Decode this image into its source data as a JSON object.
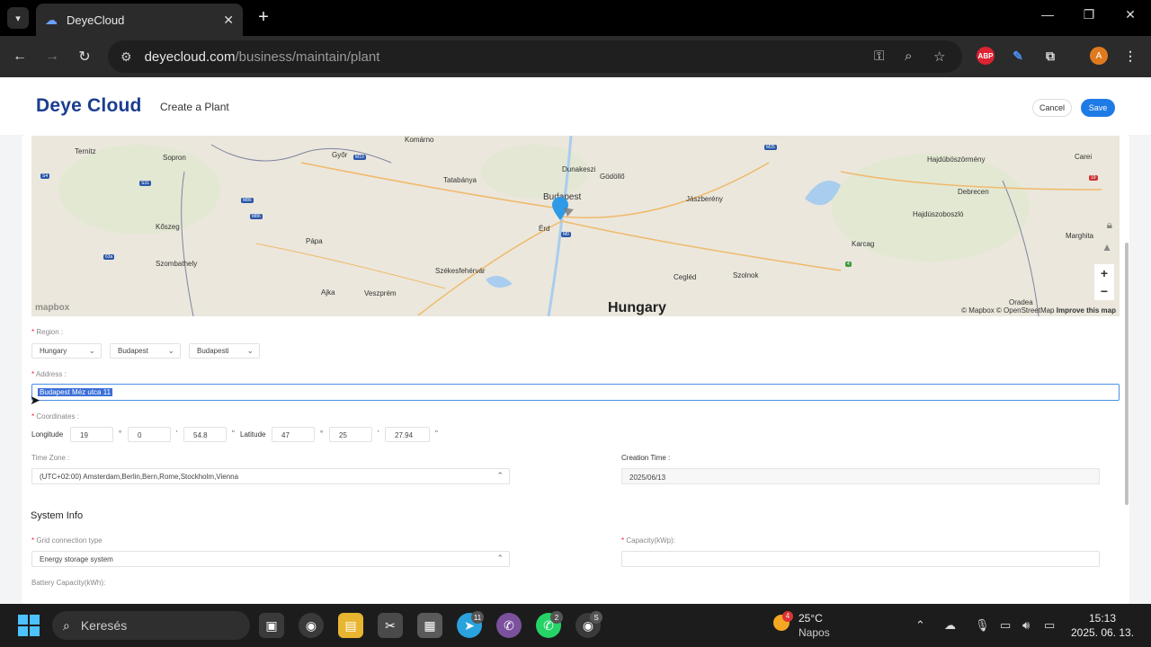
{
  "browser": {
    "tab_title": "DeyeCloud",
    "url_host": "deyecloud.com",
    "url_path": "/business/maintain/plant",
    "profile_initial": "A"
  },
  "app": {
    "logo": "Deye Cloud",
    "page_title": "Create a Plant",
    "cancel_label": "Cancel",
    "save_label": "Save"
  },
  "map": {
    "country_label": "Hungary",
    "attribution": "© Mapbox © OpenStreetMap",
    "improve": "Improve this map",
    "logo": "mapbox",
    "places": [
      "Komárno",
      "Ternitz",
      "Sopron",
      "Győr",
      "Tatabánya",
      "Dunakeszi",
      "Gödöllő",
      "Budapest",
      "Érd",
      "Jászberény",
      "Hajdúböszörmény",
      "Debrecen",
      "Hajdúszoboszló",
      "Carei",
      "Marghita",
      "Kőszeg",
      "Pápa",
      "Szombathely",
      "Székesfehérvár",
      "Veszprém",
      "Ajka",
      "Cegléd",
      "Szolnok",
      "Karcag",
      "Oradea"
    ],
    "roads": [
      "S4",
      "S31",
      "M19",
      "M86",
      "M86",
      "63a",
      "M0",
      "M25",
      "19",
      "4"
    ]
  },
  "form": {
    "region_label": "Region :",
    "region_country": "Hungary",
    "region_city": "Budapest",
    "region_district": "Budapesti",
    "address_label": "Address :",
    "address_value": "Budapest Méz utca 11",
    "coordinates_label": "Coordinates :",
    "longitude_label": "Longitude",
    "longitude": [
      "19",
      "0",
      "54.8"
    ],
    "latitude_label": "Latitude",
    "latitude": [
      "47",
      "25",
      "27.94"
    ],
    "timezone_label": "Time Zone :",
    "timezone_value": "(UTC+02:00) Amsterdam,Berlin,Bern,Rome,Stockholm,Vienna",
    "creation_label": "Creation Time :",
    "creation_value": "2025/06/13"
  },
  "system_info": {
    "title": "System Info",
    "grid_label": "Grid connection type",
    "grid_value": "Energy storage system",
    "capacity_label": "Capacity(kWp):",
    "capacity_value": "",
    "battery_label": "Battery Capacity(kWh):"
  },
  "taskbar": {
    "search_text": "Keresés",
    "weather_temp": "25°C",
    "weather_desc": "Napos",
    "weather_badge": "4",
    "time": "15:13",
    "date": "2025. 06. 13.",
    "telegram_badge": "11",
    "whatsapp_badge": "2",
    "chrome2_badge": "S"
  },
  "colors": {
    "primary": "#1e7be6",
    "logo": "#1a3d8f",
    "required": "#e22233"
  }
}
